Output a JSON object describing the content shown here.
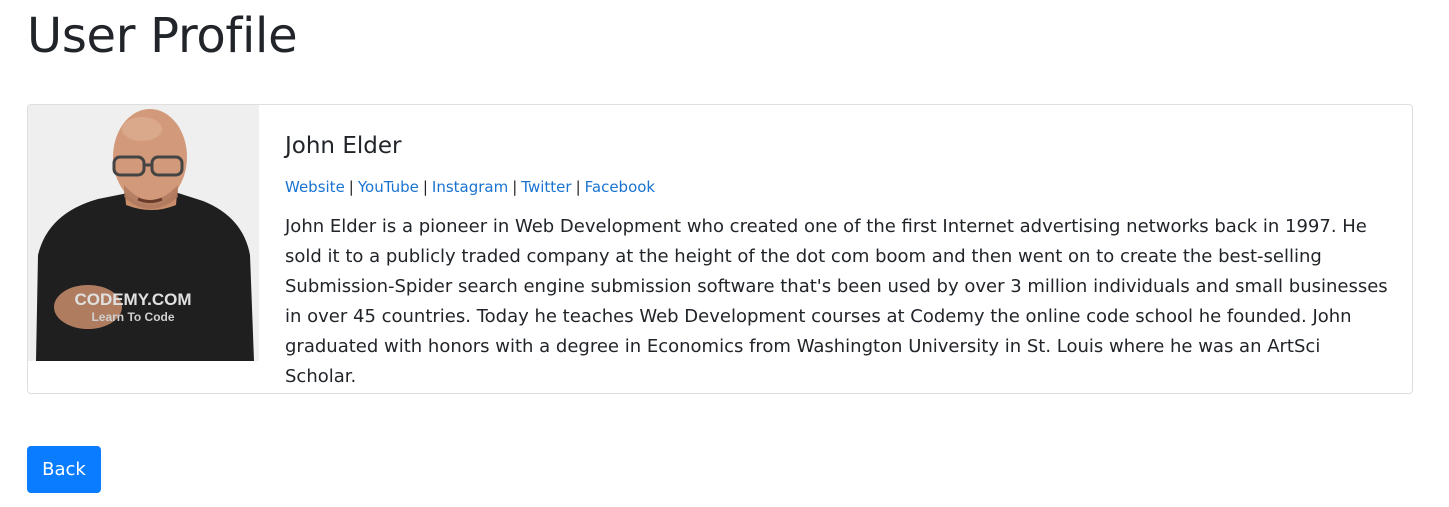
{
  "page": {
    "title": "User Profile"
  },
  "profile": {
    "name": "John Elder",
    "photo_shirt_text": "CODEMY.COM",
    "photo_shirt_subtext": "Learn To Code",
    "links": [
      {
        "label": "Website"
      },
      {
        "label": "YouTube"
      },
      {
        "label": "Instagram"
      },
      {
        "label": "Twitter"
      },
      {
        "label": "Facebook"
      }
    ],
    "link_separator": "|",
    "bio": "John Elder is a pioneer in Web Development who created one of the first Internet advertising networks back in 1997. He sold it to a publicly traded company at the height of the dot com boom and then went on to create the best-selling Submission-Spider search engine submission software that's been used by over 3 million individuals and small businesses in over 45 countries. Today he teaches Web Development courses at Codemy the online code school he founded. John graduated with honors with a degree in Economics from Washington University in St. Louis where he was an ArtSci Scholar."
  },
  "actions": {
    "back_label": "Back"
  },
  "colors": {
    "link": "#1a73d1",
    "primary_button": "#0a7cff",
    "card_border": "#dfdfdf",
    "text": "#212529"
  }
}
